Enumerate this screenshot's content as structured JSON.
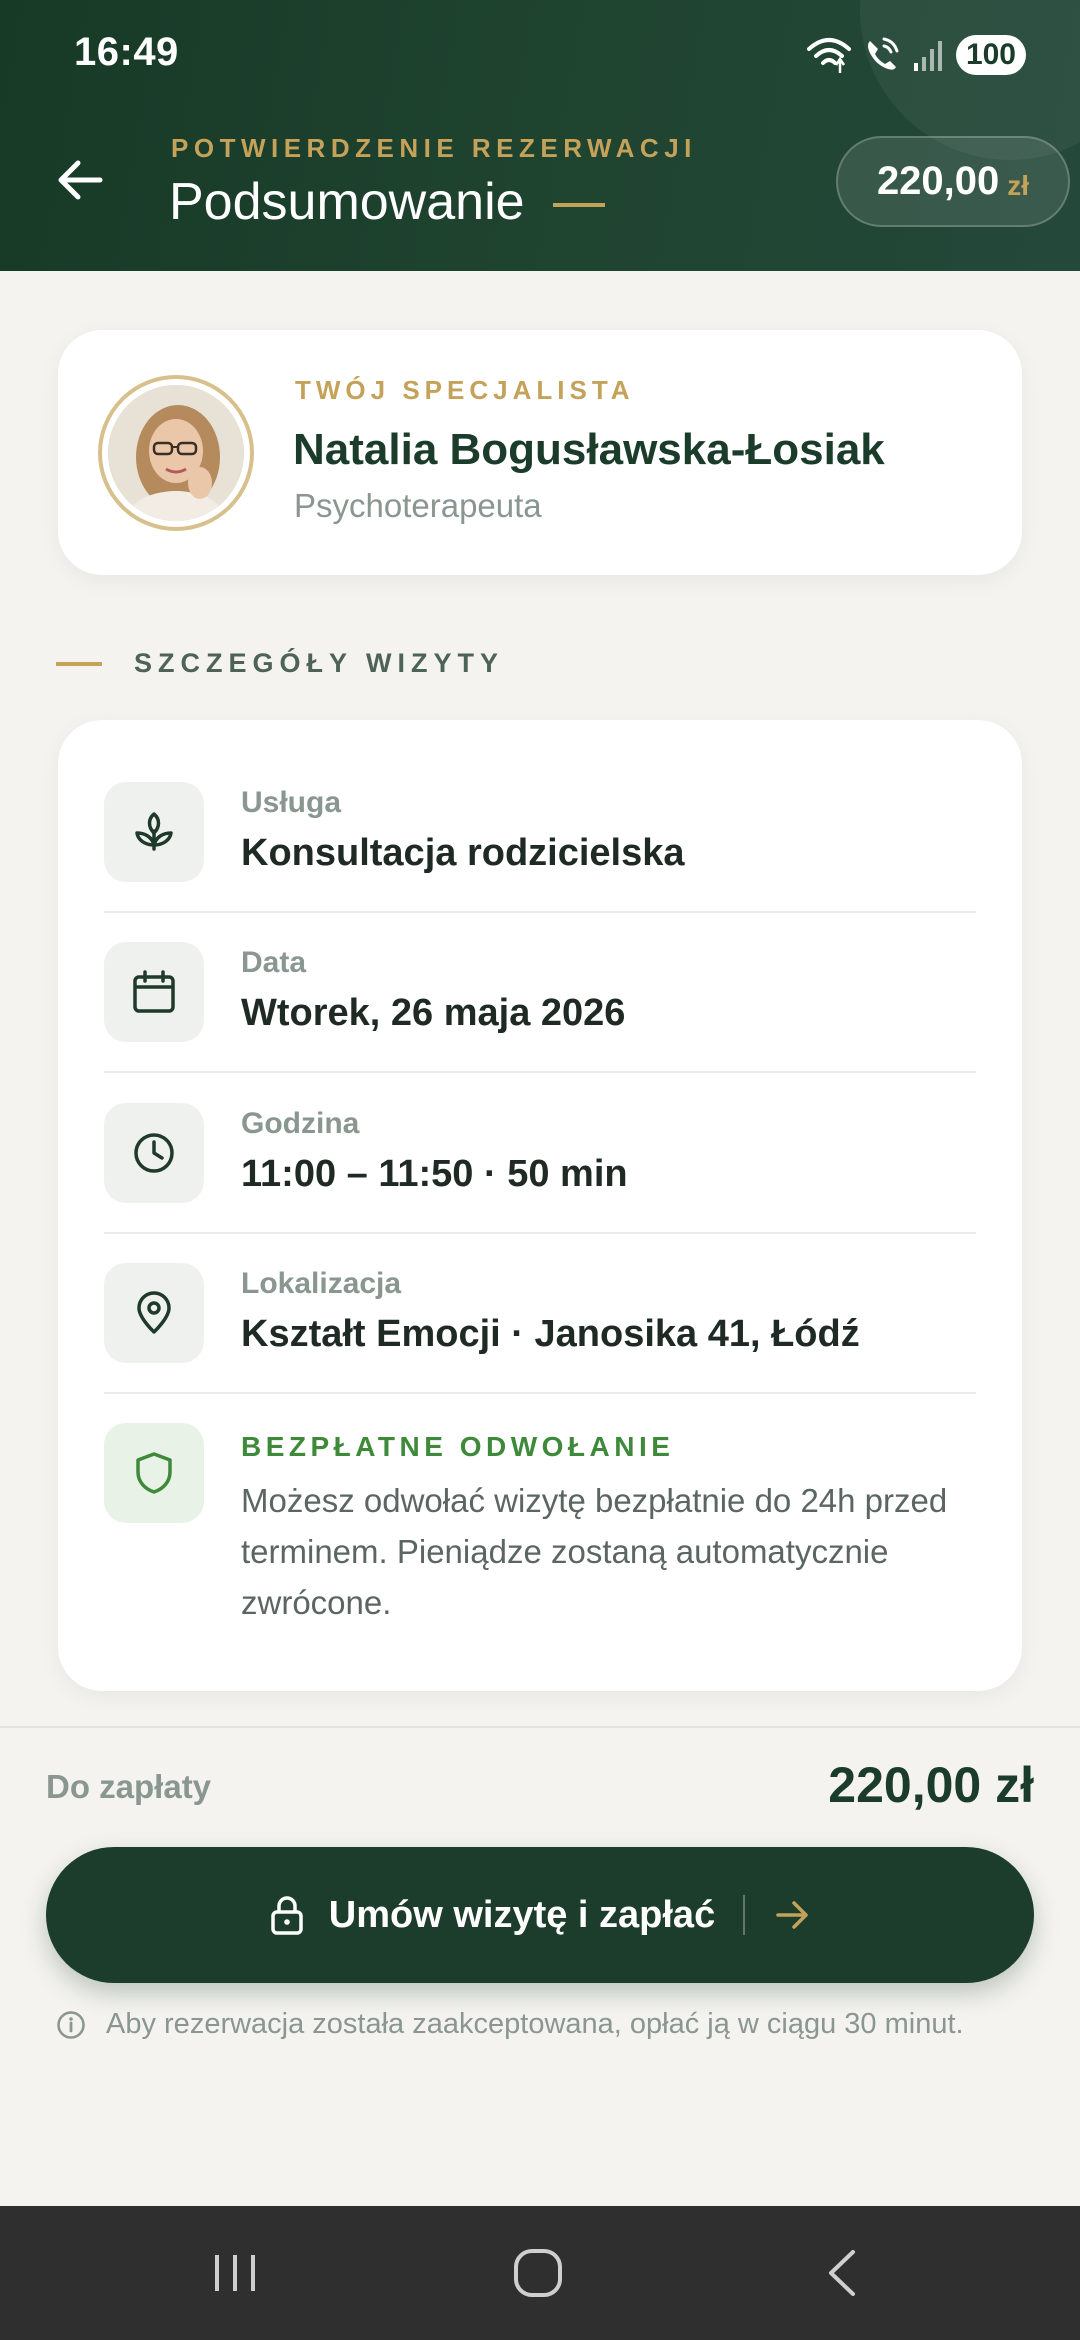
{
  "status_bar": {
    "time": "16:49",
    "battery": "100"
  },
  "header": {
    "eyebrow": "POTWIERDZENIE REZERWACJI",
    "title": "Podsumowanie",
    "price_amount": "220,00",
    "price_currency": "zł"
  },
  "specialist": {
    "eyebrow": "TWÓJ SPECJALISTA",
    "name": "Natalia Bogusławska-Łosiak",
    "role": "Psychoterapeuta"
  },
  "details": {
    "section_title": "SZCZEGÓŁY WIZYTY",
    "rows": [
      {
        "icon": "sprout-icon",
        "label": "Usługa",
        "value": "Konsultacja rodzicielska"
      },
      {
        "icon": "calendar-icon",
        "label": "Data",
        "value": "Wtorek, 26 maja 2026"
      },
      {
        "icon": "clock-icon",
        "label": "Godzina",
        "value": "11:00 – 11:50 · 50 min"
      },
      {
        "icon": "location-pin-icon",
        "label": "Lokalizacja",
        "value": "Kształt Emocji · Janosika 41, Łódź"
      }
    ],
    "cancellation": {
      "icon": "shield-icon",
      "label": "BEZPŁATNE ODWOŁANIE",
      "text": "Możesz odwołać wizytę bezpłatnie do 24h przed terminem. Pieniądze zostaną automatycznie zwrócone."
    }
  },
  "payment": {
    "due_label": "Do zapłaty",
    "due_amount": "220,00 zł",
    "button_label": "Umów wizytę i zapłać",
    "note": "Aby rezerwacja została zaakceptowana, opłać ją w ciągu 30 minut."
  },
  "colors": {
    "header_green": "#1f4430",
    "accent_gold": "#c4a25a",
    "button_green": "#1c3d2b",
    "success_green": "#3e8a3a"
  }
}
